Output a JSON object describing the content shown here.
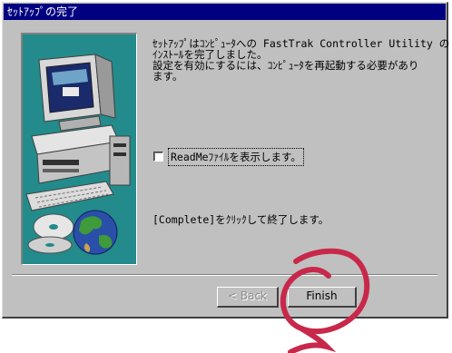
{
  "window": {
    "title": "ｾｯﾄｱｯﾌﾟの完了"
  },
  "message": {
    "line1": "ｾｯﾄｱｯﾌﾟはｺﾝﾋﾟｭｰﾀへの FastTrak Controller Utility の",
    "line2": "ｲﾝｽﾄｰﾙを完了しました。",
    "line3": "設定を有効にするには、ｺﾝﾋﾟｭｰﾀを再起動する必要があり",
    "line4": "ます。"
  },
  "readme": {
    "label": "ReadMeﾌｧｲﾙを表示します。",
    "checked": false
  },
  "instruction": "[Complete]をｸﾘｯｸして終了します。",
  "buttons": {
    "back": "< Back",
    "finish": "Finish"
  },
  "colors": {
    "titlebar": "#000080",
    "dialog": "#c0c0c0",
    "art_bg": "#238b8b",
    "annotation": "#c8284a"
  }
}
